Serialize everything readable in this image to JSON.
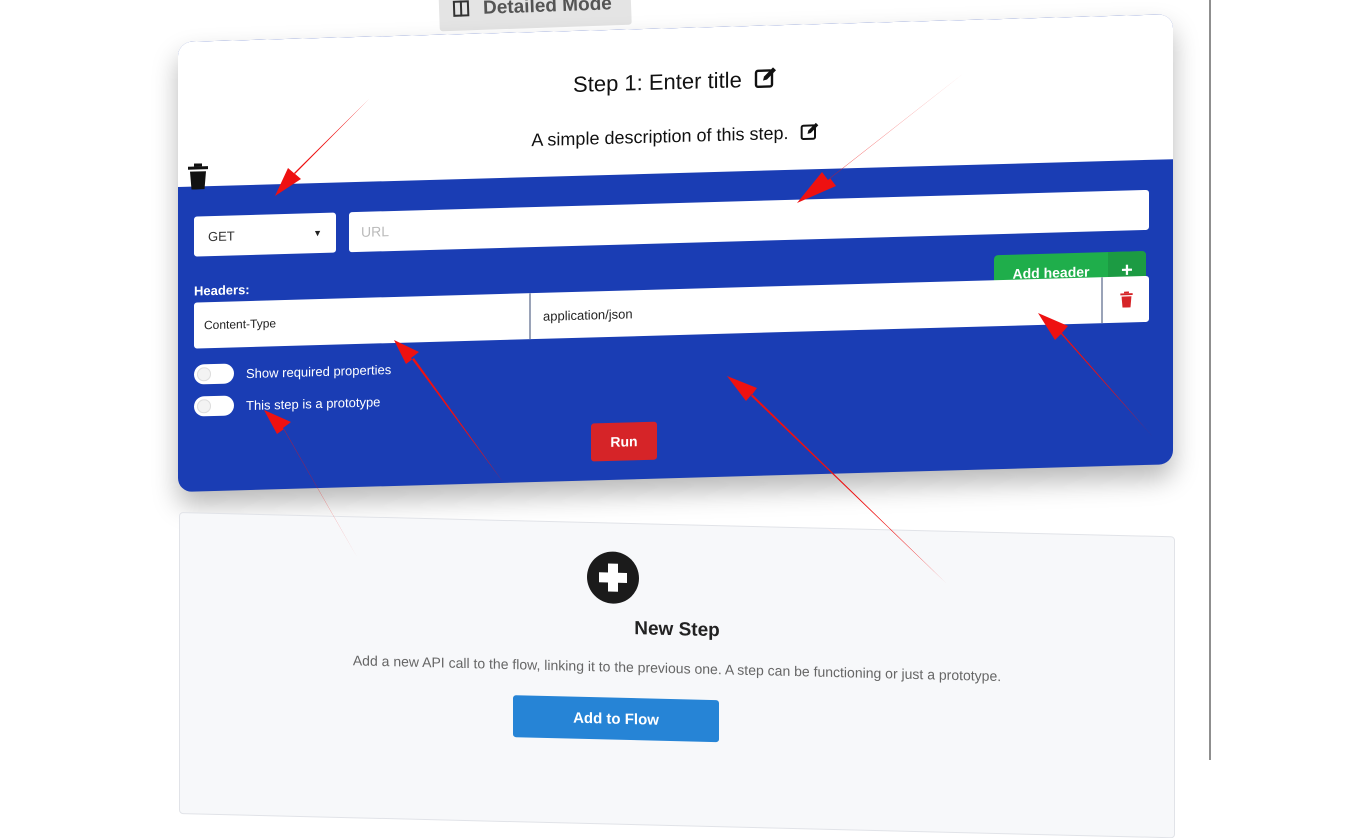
{
  "mode_tab": {
    "label": "Detailed Mode"
  },
  "step": {
    "title": "Step 1: Enter title",
    "description": "A simple description of this step.",
    "method": {
      "selected": "GET"
    },
    "url": {
      "value": "",
      "placeholder": "URL"
    },
    "add_header_label": "Add header",
    "headers_label": "Headers:",
    "headers": [
      {
        "key": "Content-Type",
        "value": "application/json"
      }
    ],
    "toggles": {
      "show_required": {
        "label": "Show required properties",
        "on": false
      },
      "prototype": {
        "label": "This step is a prototype",
        "on": false
      }
    },
    "run_label": "Run"
  },
  "new_step": {
    "title": "New Step",
    "description": "Add a new API call to the flow, linking it to the previous one. A step can be functioning or just a prototype.",
    "button_label": "Add to Flow"
  },
  "colors": {
    "card_blue": "#1a3db4",
    "add_green": "#1fae4b",
    "run_red": "#d62428",
    "flow_blue": "#2684d6",
    "arrow_red": "#ee1111"
  }
}
